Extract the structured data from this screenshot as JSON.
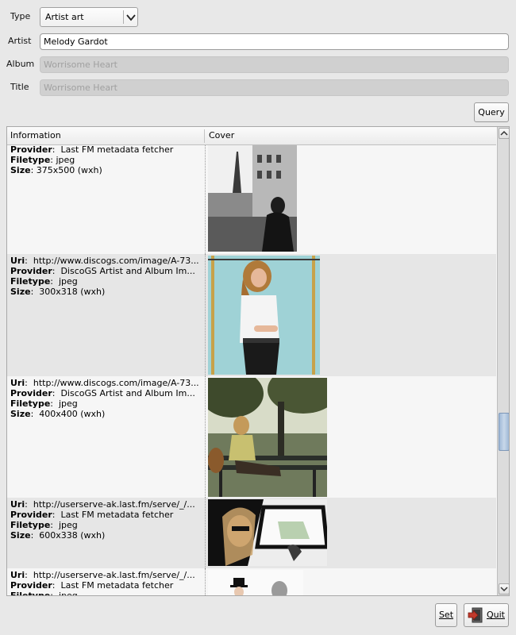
{
  "form": {
    "type_label": "Type",
    "type_value": "Artist art",
    "artist_label": "Artist",
    "artist_value": "Melody Gardot",
    "album_label": "Album",
    "album_placeholder": "Worrisome Heart",
    "title_label": "Title",
    "title_placeholder": "Worrisome Heart"
  },
  "buttons": {
    "query": "Query",
    "set": "Set",
    "quit": "Quit"
  },
  "results": {
    "columns": [
      "Information",
      "Cover"
    ],
    "field_labels": {
      "uri": "Uri",
      "provider": "Provider",
      "filetype": "Filetype",
      "size": "Size"
    },
    "rows": [
      {
        "provider": "Last FM metadata fetcher",
        "filetype": "jpeg",
        "size": "375x500 (wxh)"
      },
      {
        "uri": "http://www.discogs.com/image/A-73...",
        "provider": "DiscoGS Artist and Album Im...",
        "filetype": "jpeg",
        "size": "300x318 (wxh)"
      },
      {
        "uri": "http://www.discogs.com/image/A-73...",
        "provider": "DiscoGS Artist and Album Im...",
        "filetype": "jpeg",
        "size": "400x400 (wxh)"
      },
      {
        "uri": "http://userserve-ak.last.fm/serve/_/...",
        "provider": "Last FM metadata fetcher",
        "filetype": "jpeg",
        "size": "600x338 (wxh)"
      },
      {
        "uri": "http://userserve-ak.last.fm/serve/_/...",
        "provider": "Last FM metadata fetcher",
        "filetype": "jpeg"
      }
    ]
  },
  "colors": {
    "window_bg": "#e8e8e8",
    "scroll_thumb": "#b7cbe3",
    "quit_icon": "#c0392b"
  },
  "icons": [
    "chevron-down-icon",
    "scroll-up-icon",
    "scroll-down-icon",
    "quit-icon"
  ]
}
